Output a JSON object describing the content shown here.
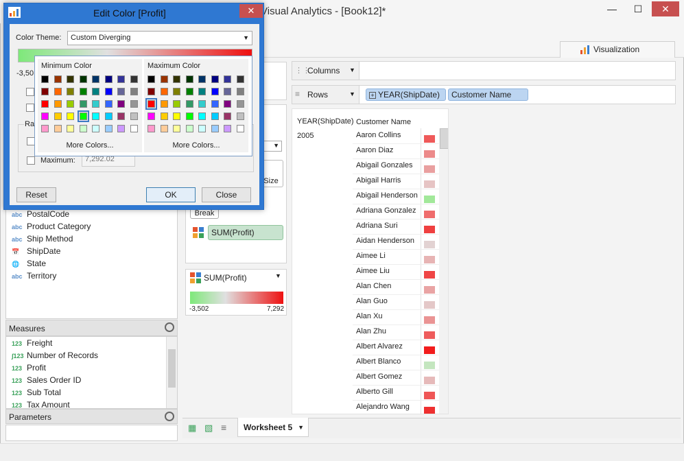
{
  "app": {
    "title": "Visual Analytics - [Book12]*",
    "window_buttons": [
      "—",
      "☐",
      "✕"
    ],
    "tab_visualization": "Visualization"
  },
  "dimensions": {
    "fields": [
      {
        "type": "abc",
        "name": "PostalCode"
      },
      {
        "type": "abc",
        "name": "Product Category"
      },
      {
        "type": "abc",
        "name": "Ship Method"
      },
      {
        "type": "date",
        "name": "ShipDate"
      },
      {
        "type": "geo",
        "name": "State"
      },
      {
        "type": "abc",
        "name": "Territory"
      }
    ]
  },
  "measures": {
    "header": "Measures",
    "fields": [
      {
        "type": "123",
        "name": "Freight"
      },
      {
        "type": "calc",
        "name": "Number of Records"
      },
      {
        "type": "123",
        "name": "Profit"
      },
      {
        "type": "123",
        "name": "Sales Order ID"
      },
      {
        "type": "123",
        "name": "Sub Total"
      },
      {
        "type": "123",
        "name": "Tax Amount"
      }
    ]
  },
  "parameters": {
    "header": "Parameters"
  },
  "shelves": {
    "columns_label": "Columns",
    "rows_label": "Rows",
    "rows_pills": [
      "YEAR(ShipDate)",
      "Customer Name"
    ],
    "rows_pill_prefix": "+"
  },
  "marks": {
    "break_label": "Break",
    "color_pill": "SUM(Profit)",
    "size_label": "Size"
  },
  "legend": {
    "title": "SUM(Profit)",
    "min": "-3,502",
    "max": "7,292",
    "colors": {
      "min": "#7ee87a",
      "mid": "#e0e0e0",
      "max": "#ee1111"
    }
  },
  "view": {
    "col_headers": [
      "YEAR(ShipDate)",
      "Customer Name"
    ],
    "year": "2005",
    "rows": [
      {
        "name": "Aaron Collins",
        "color": "#ef5a5a"
      },
      {
        "name": "Aaron Diaz",
        "color": "#ec8a8a"
      },
      {
        "name": "Abigail Gonzales",
        "color": "#e9a0a0"
      },
      {
        "name": "Abigail Harris",
        "color": "#e6c4c4"
      },
      {
        "name": "Abigail Henderson",
        "color": "#a2e89a"
      },
      {
        "name": "Adriana Gonzalez",
        "color": "#ef6c6c"
      },
      {
        "name": "Adriana Suri",
        "color": "#ef4040"
      },
      {
        "name": "Aidan Henderson",
        "color": "#e2d2d2"
      },
      {
        "name": "Aimee Li",
        "color": "#e7b4b4"
      },
      {
        "name": "Aimee Liu",
        "color": "#ef4545"
      },
      {
        "name": "Alan Chen",
        "color": "#e9a4a4"
      },
      {
        "name": "Alan Guo",
        "color": "#e4c8c8"
      },
      {
        "name": "Alan Xu",
        "color": "#ea9494"
      },
      {
        "name": "Alan Zhu",
        "color": "#ee5c5c"
      },
      {
        "name": "Albert Alvarez",
        "color": "#f21c1c"
      },
      {
        "name": "Albert Blanco",
        "color": "#c4e6bf"
      },
      {
        "name": "Albert Gomez",
        "color": "#e6baba"
      },
      {
        "name": "Alberto Gill",
        "color": "#ef5656"
      },
      {
        "name": "Alejandro Wang",
        "color": "#ee3030"
      }
    ]
  },
  "worksheet_tab": "Worksheet 5",
  "dialog": {
    "title": "Edit Color [Profit]",
    "close_glyph": "✕",
    "color_theme_label": "Color Theme:",
    "color_theme_value": "Custom Diverging",
    "range_min_partial": "-3,50",
    "range_group_partial": "Ran",
    "maximum_label": "Maximum:",
    "maximum_value": "7,292.02",
    "reset": "Reset",
    "ok": "OK",
    "close": "Close"
  },
  "picker": {
    "min_title": "Minimum Color",
    "max_title": "Maximum Color",
    "more_colors": "More Colors...",
    "palette": [
      [
        "#000000",
        "#993300",
        "#333300",
        "#003300",
        "#003366",
        "#000080",
        "#333399",
        "#333333"
      ],
      [
        "#800000",
        "#ff6600",
        "#808000",
        "#008000",
        "#008080",
        "#0000ff",
        "#666699",
        "#808080"
      ],
      [
        "#ff0000",
        "#ff9900",
        "#99cc00",
        "#339966",
        "#33cccc",
        "#3366ff",
        "#800080",
        "#969696"
      ],
      [
        "#ff00ff",
        "#ffcc00",
        "#ffff00",
        "#00ff00",
        "#00ffff",
        "#00ccff",
        "#993366",
        "#c0c0c0"
      ],
      [
        "#ff99cc",
        "#ffcc99",
        "#ffff99",
        "#ccffcc",
        "#ccffff",
        "#99ccff",
        "#cc99ff",
        "#ffffff"
      ]
    ],
    "min_selected": [
      3,
      3
    ],
    "max_selected": [
      2,
      0
    ]
  }
}
